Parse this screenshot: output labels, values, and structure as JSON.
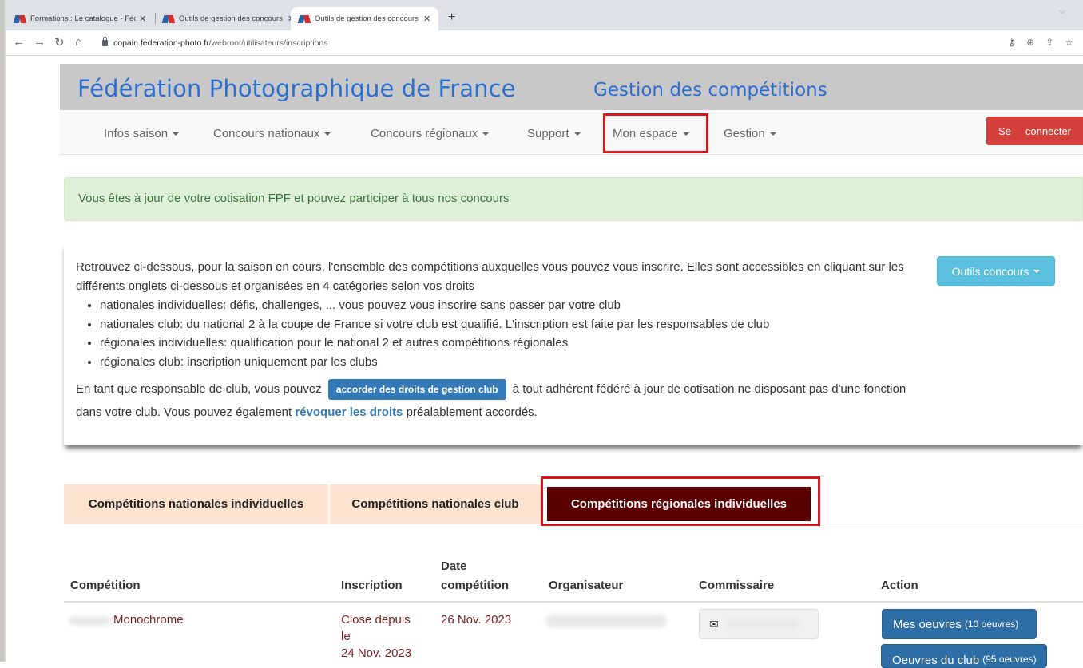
{
  "browser": {
    "tabs": [
      {
        "title": "Formations : Le catalogue - Fédé"
      },
      {
        "title": "Outils de gestion des concours"
      },
      {
        "title": "Outils de gestion des concours"
      }
    ],
    "url_host": "copain.federation-photo.fr",
    "url_path": "/webroot/utilisateurs/inscriptions"
  },
  "header": {
    "brand": "Fédération Photographique de France",
    "subtitle": "Gestion des compétitions"
  },
  "nav": {
    "items": [
      "Infos saison",
      "Concours nationaux",
      "Concours régionaux",
      "Support",
      "Mon espace",
      "Gestion"
    ],
    "connect_label_1": "Se",
    "connect_label_2": "connecter"
  },
  "alert": {
    "text": "Vous êtes à jour de votre cotisation FPF et pouvez participer à tous nos concours"
  },
  "info": {
    "intro": "Retrouvez ci-dessous, pour la saison en cours, l'ensemble des compétitions auxquelles vous pouvez vous inscrire. Elles sont accessibles en cliquant sur les différents onglets ci-dessous et organisées en 4 catégories selon vos droits",
    "bullets": [
      "nationales individuelles: défis, challenges, ... vous pouvez vous inscrire sans passer par votre club",
      "nationales club: du national 2 à la coupe de France si votre club est qualifié. L'inscription est faite par les responsables de club",
      "régionales individuelles: qualification pour le national 2 et autres compétitions régionales",
      "régionales club: inscription uniquement par les clubs"
    ],
    "para_part1": "En tant que responsable de club, vous pouvez",
    "grant_button": "accorder des droits de gestion club",
    "para_part2": "à tout adhérent fédéré à jour de cotisation ne disposant pas d'une fonction dans votre club. Vous pouvez également",
    "revoke_link": "révoquer les droits",
    "para_part3": "préalablement accordés.",
    "tools_button": "Outils concours"
  },
  "competition_tabs": [
    "Compétitions nationales individuelles",
    "Compétitions nationales club",
    "Compétitions régionales individuelles"
  ],
  "table": {
    "headers": {
      "competition": "Compétition",
      "inscription": "Inscription",
      "date_line1": "Date",
      "date_line2": "compétition",
      "organisateur": "Organisateur",
      "commissaire": "Commissaire",
      "action": "Action"
    },
    "row": {
      "competition": "Monochrome",
      "inscription_l1": "Close depuis",
      "inscription_l2": "le",
      "inscription_l3": "24 Nov. 2023",
      "date": "26 Nov. 2023",
      "mail_icon": "✉",
      "btn_mes_oeuvres": "Mes oeuvres",
      "btn_mes_oeuvres_count": "(10 oeuvres)",
      "btn_club": "Oeuvres du club",
      "btn_club_count": "(95 oeuvres)"
    }
  },
  "colors": {
    "brand_blue": "#2d6fcf",
    "active_tab": "#5a0000",
    "highlight_red": "#d9161e",
    "alert_bg": "#dff0d8"
  }
}
